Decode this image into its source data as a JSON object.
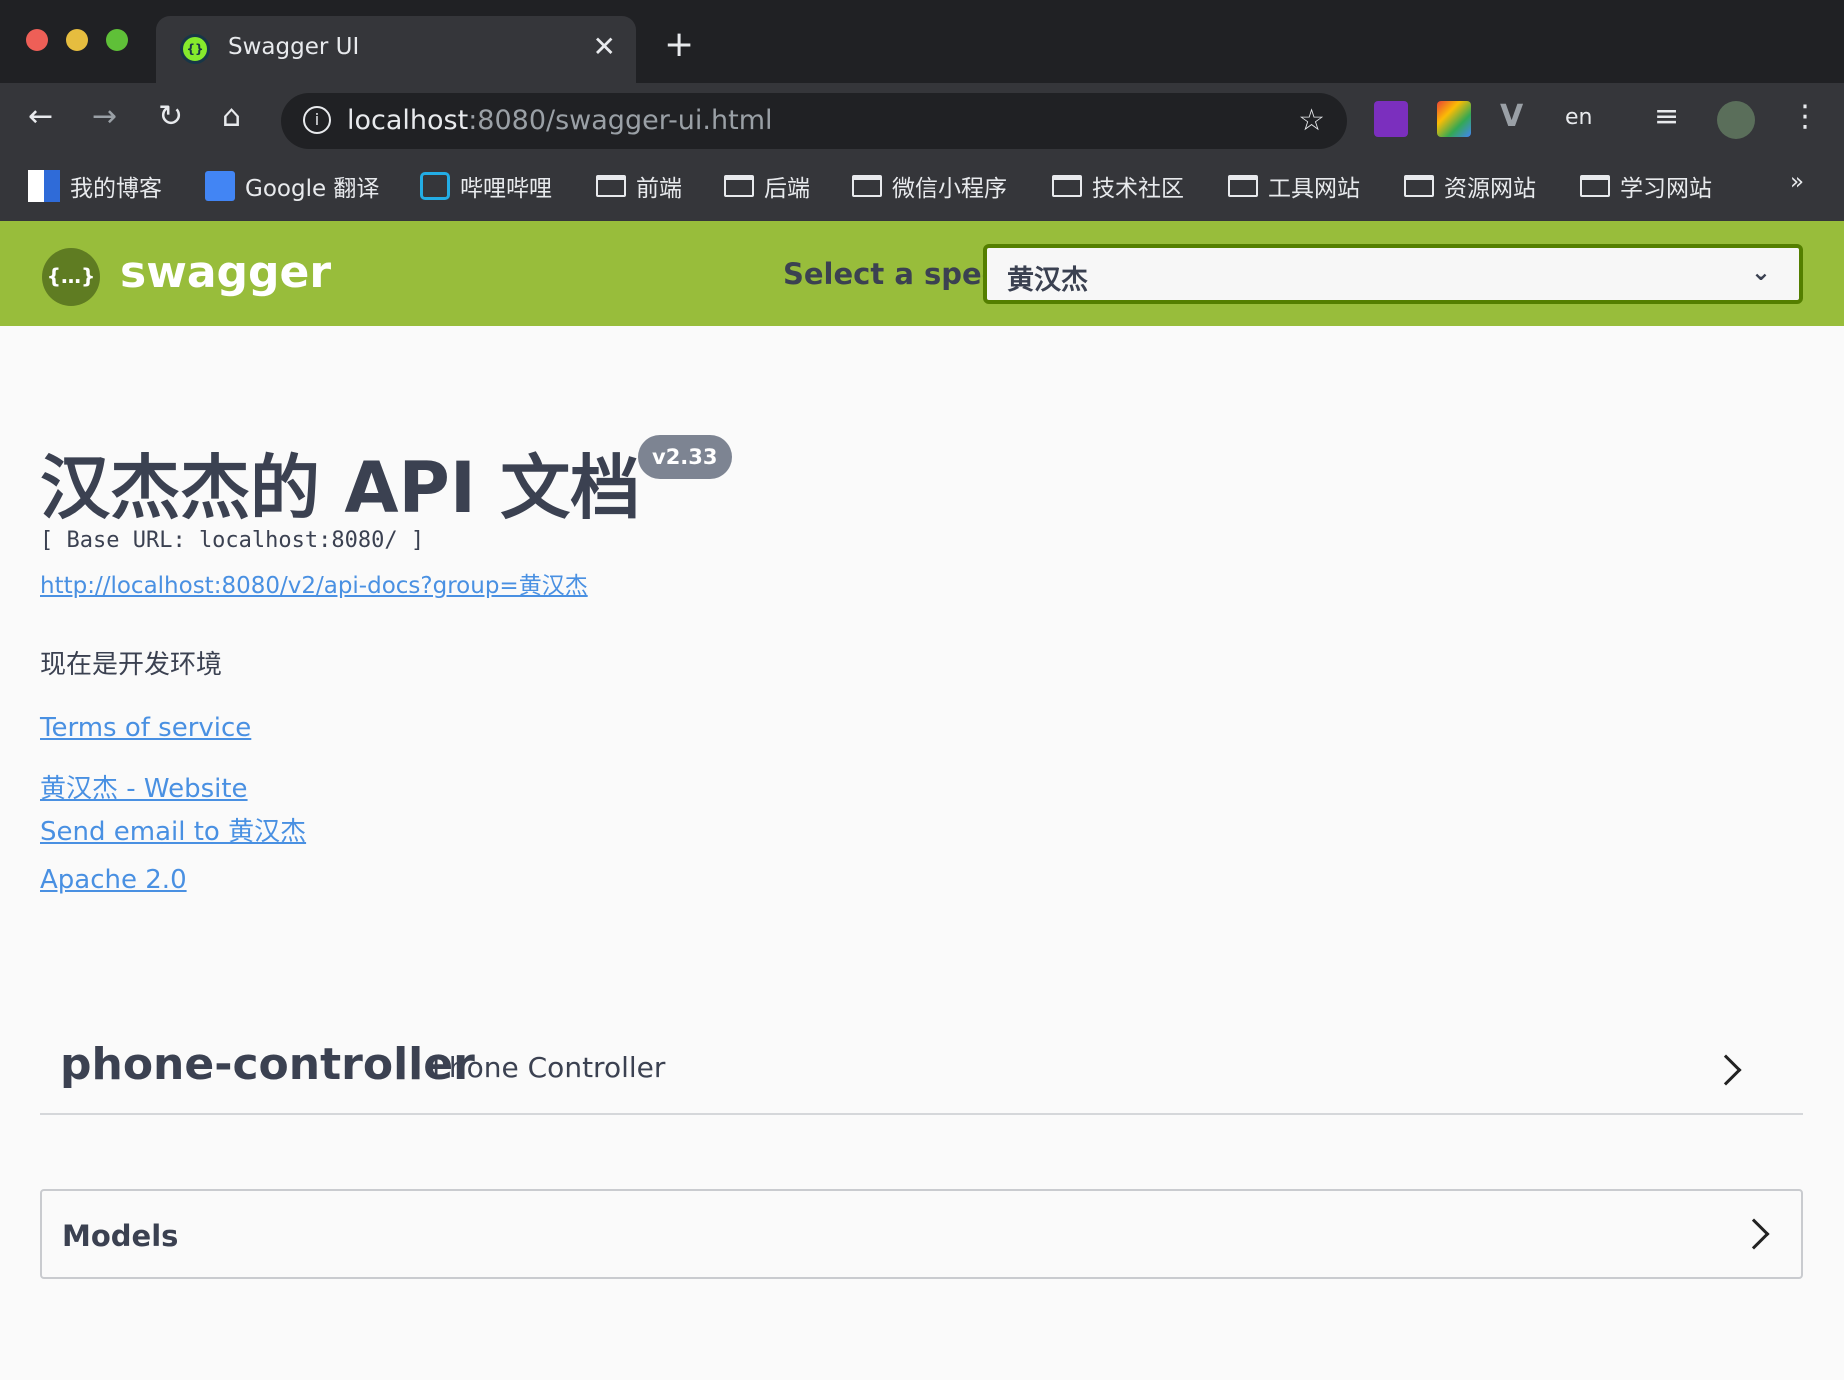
{
  "browser": {
    "tab_title": "Swagger UI",
    "url_host": "localhost",
    "url_rest": ":8080/swagger-ui.html",
    "bookmarks": [
      "我的博客",
      "Google 翻译",
      "哔哩哔哩",
      "前端",
      "后端",
      "微信小程序",
      "技术社区",
      "工具网站",
      "资源网站",
      "学习网站"
    ],
    "more": "»",
    "traffic_colors": [
      "#ee5f57",
      "#e6bd3f",
      "#5fc038"
    ]
  },
  "header": {
    "logo_text": "swagger",
    "select_label": "Select a spec",
    "selected_spec": "黄汉杰",
    "accent": "#98bd3b"
  },
  "info": {
    "title": "汉杰杰的 API 文档",
    "version": "v2.33",
    "base_url": "[ Base URL: localhost:8080/ ]",
    "spec_link": "http://localhost:8080/v2/api-docs?group=黄汉杰",
    "description": "现在是开发环境",
    "terms": "Terms of service",
    "website": "黄汉杰 - Website",
    "email": "Send email to 黄汉杰",
    "license": "Apache 2.0"
  },
  "tags": [
    {
      "name": "phone-controller",
      "description": "Phone Controller"
    }
  ],
  "models": {
    "label": "Models"
  }
}
